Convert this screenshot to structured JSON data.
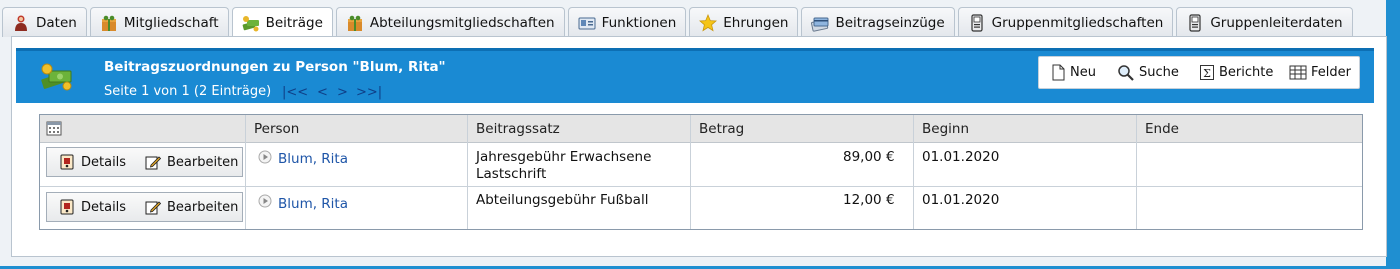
{
  "tabs": [
    {
      "label": "Daten",
      "icon": "person-icon"
    },
    {
      "label": "Mitgliedschaft",
      "icon": "gift-icon"
    },
    {
      "label": "Beiträge",
      "icon": "money-icon",
      "active": true
    },
    {
      "label": "Abteilungsmitgliedschaften",
      "icon": "gift-icon"
    },
    {
      "label": "Funktionen",
      "icon": "id-card-icon"
    },
    {
      "label": "Ehrungen",
      "icon": "star-icon"
    },
    {
      "label": "Beitragseinzüge",
      "icon": "card-icon"
    },
    {
      "label": "Gruppenmitgliedschaften",
      "icon": "phone-icon"
    },
    {
      "label": "Gruppenleiterdaten",
      "icon": "phone-icon"
    }
  ],
  "header": {
    "title": "Beitragszuordnungen zu Person \"Blum, Rita\"",
    "paging": "Seite 1 von 1 (2 Einträge)",
    "nav": {
      "first": "|<<",
      "prev": "<",
      "next": ">",
      "last": ">>|"
    }
  },
  "toolbar": {
    "new": "Neu",
    "search": "Suche",
    "reports": "Berichte",
    "fields": "Felder"
  },
  "table": {
    "columns": [
      "Person",
      "Beitragssatz",
      "Betrag",
      "Beginn",
      "Ende"
    ],
    "rows": [
      {
        "details": "Details",
        "edit": "Bearbeiten",
        "person": "Blum, Rita",
        "rate_line1": "Jahresgebühr Erwachsene",
        "rate_line2": "Lastschrift",
        "amount": "89,00 €",
        "start": "01.01.2020",
        "end": ""
      },
      {
        "details": "Details",
        "edit": "Bearbeiten",
        "person": "Blum, Rita",
        "rate_line1": "Abteilungsgebühr Fußball",
        "rate_line2": "",
        "amount": "12,00 €",
        "start": "01.01.2020",
        "end": ""
      }
    ]
  },
  "colors": {
    "accent": "#1a8ad3",
    "link": "#1f56a8"
  }
}
